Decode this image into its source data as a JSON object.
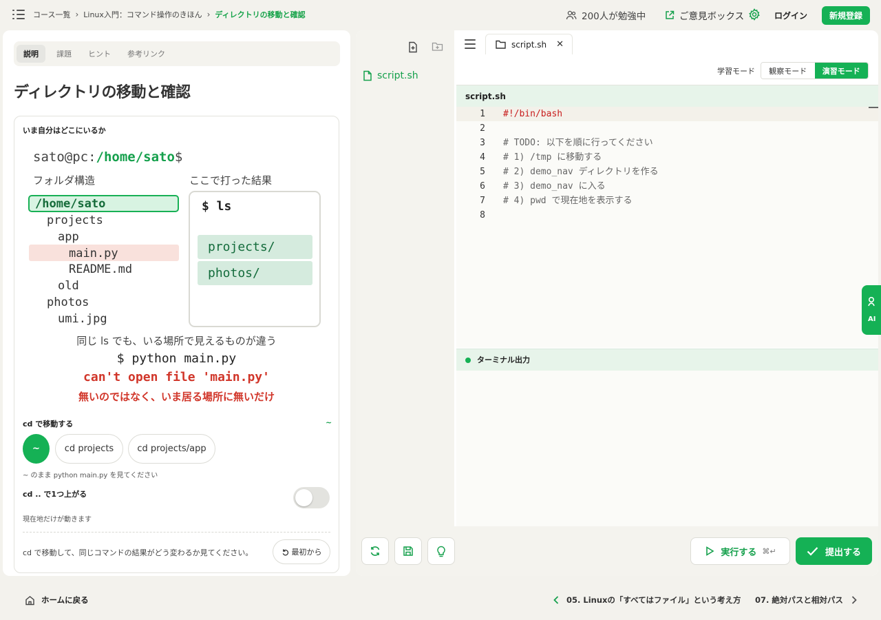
{
  "breadcrumbs": [
    "コース一覧",
    "Linux入門：コマンド操作のきほん",
    "ディレクトリの移動と確認"
  ],
  "header": {
    "learners": "200人が勉強中",
    "feedback": "ご意見ボックス",
    "login": "ログイン",
    "signup": "新規登録"
  },
  "tabs": [
    "説明",
    "課題",
    "ヒント",
    "参考リンク"
  ],
  "lesson": {
    "title": "ディレクトリの移動と確認",
    "card_heading": "いま自分はどこにいるか",
    "prompt_user": "sato@pc:",
    "prompt_path": "/home/sato",
    "prompt_end": "$",
    "tree_label": "フォルダ構造",
    "result_label": "ここで打った結果",
    "tree": [
      "/home/sato",
      "projects",
      "app",
      "main.py",
      "README.md",
      "old",
      "photos",
      "umi.jpg"
    ],
    "ls_command": "$ ls",
    "ls_results": [
      "projects/",
      "photos/"
    ],
    "note": "同じ ls でも、いる場所で見えるものが違う",
    "python_command": "$ python main.py",
    "error_text": "can't open file 'main.py'",
    "error_note": "無いのではなく、いま居る場所に無いだけ",
    "cd_heading": "cd で移動する",
    "cd_current": "~",
    "cd_buttons": [
      "~",
      "cd projects",
      "cd projects/app"
    ],
    "cd_hint": "~ のまま python main.py を見てください",
    "up_heading": "cd .. で1つ上がる",
    "up_sub": "現在地だけが動きます",
    "bottom_message": "cd で移動して、同じコマンドの結果がどう変わるか見てください。",
    "reset": "最初から"
  },
  "editor": {
    "file_name": "script.sh",
    "mode_label": "学習モード",
    "mode_observe": "観察モード",
    "mode_practice": "演習モード",
    "code_header": "script.sh",
    "code_lines": [
      "#!/bin/bash",
      "",
      "# TODO: 以下を順に行ってください",
      "# 1) /tmp に移動する",
      "# 2) demo_nav ディレクトリを作る",
      "# 3) demo_nav に入る",
      "# 4) pwd で現在地を表示する",
      ""
    ],
    "terminal_header": "ターミナル出力",
    "run": "実行する",
    "run_shortcut": "⌘↵",
    "submit": "提出する"
  },
  "ai_tab": "AI",
  "bottom_nav": {
    "home": "ホームに戻る",
    "prev": "05. Linuxの「すべてはファイル」という考え方",
    "next": "07. 絶対パスと相対パス"
  },
  "colors": {
    "accent": "#15b155",
    "error": "#d1362a",
    "code_comment": "#666666",
    "shebang": "#c81d1d"
  },
  "icons": [
    "menu-icon",
    "users-icon",
    "external-link-icon",
    "gear-icon",
    "new-file-icon",
    "new-folder-icon",
    "file-icon",
    "folder-icon",
    "close-icon",
    "refresh-icon",
    "save-icon",
    "lightbulb-icon",
    "play-icon",
    "check-icon",
    "home-icon",
    "chevron-left-icon",
    "chevron-right-icon",
    "undo-icon"
  ]
}
